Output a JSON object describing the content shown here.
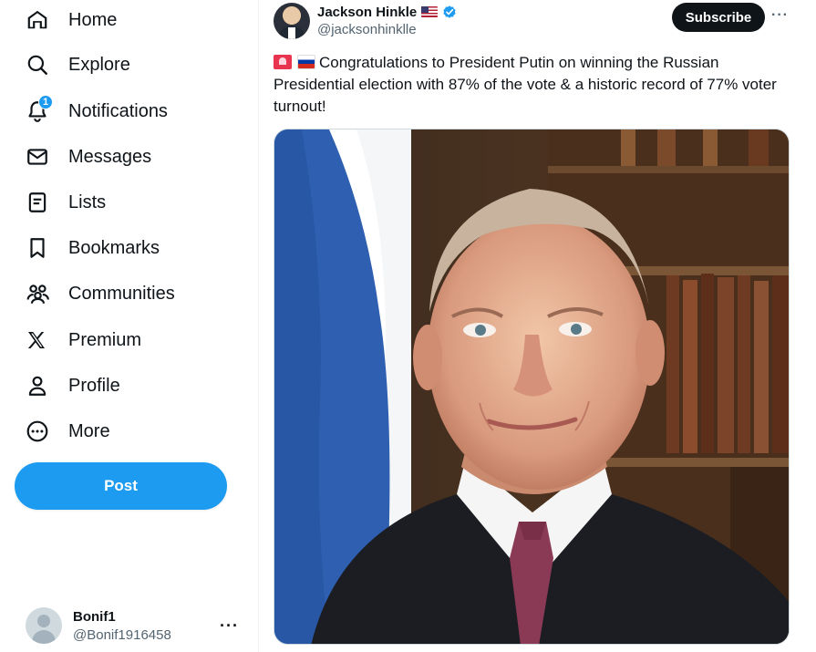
{
  "sidebar": {
    "items": [
      {
        "label": "Home",
        "icon": "home-icon"
      },
      {
        "label": "Explore",
        "icon": "search-icon"
      },
      {
        "label": "Notifications",
        "icon": "bell-icon",
        "badge": "1"
      },
      {
        "label": "Messages",
        "icon": "envelope-icon"
      },
      {
        "label": "Lists",
        "icon": "list-icon"
      },
      {
        "label": "Bookmarks",
        "icon": "bookmark-icon"
      },
      {
        "label": "Communities",
        "icon": "people-icon"
      },
      {
        "label": "Premium",
        "icon": "x-logo-icon"
      },
      {
        "label": "Profile",
        "icon": "person-icon"
      },
      {
        "label": "More",
        "icon": "more-circle-icon"
      }
    ],
    "post_label": "Post",
    "account": {
      "display_name": "Bonif1",
      "handle": "@Bonif1916458"
    }
  },
  "tweet": {
    "author_name": "Jackson Hinkle",
    "author_handle": "@jacksonhinklle",
    "subscribe_label": "Subscribe",
    "text": "Congratulations to President Putin on winning the Russian Presidential election with 87% of the vote & a historic record of 77% voter turnout!"
  },
  "colors": {
    "accent": "#1d9bf0",
    "text": "#0f1419",
    "muted": "#536471"
  }
}
